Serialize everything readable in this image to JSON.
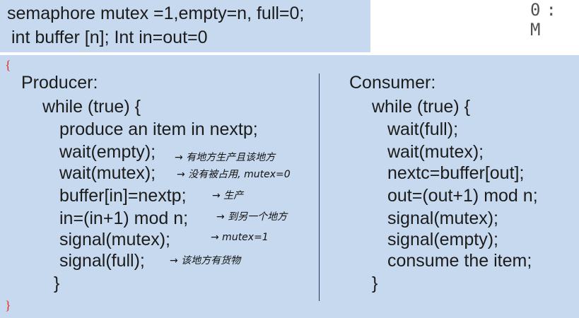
{
  "header": {
    "line1": "semaphore mutex =1,empty=n, full=0;",
    "line2": "int buffer [n];  Int in=out=0"
  },
  "corner_text": "0: M",
  "braces": {
    "open": "{",
    "close": "}"
  },
  "producer": {
    "title": "Producer:",
    "lines": [
      "while (true) {",
      "produce an item in nextp;",
      "wait(empty);",
      "wait(mutex);",
      "buffer[in]=nextp;",
      "in=(in+1) mod n;",
      "signal(mutex);",
      "signal(full);",
      "}"
    ]
  },
  "consumer": {
    "title": "Consumer:",
    "lines": [
      "while (true) {",
      "wait(full);",
      "wait(mutex);",
      "nextc=buffer[out];",
      "out=(out+1) mod n;",
      "signal(mutex);",
      "signal(empty);",
      "consume the item;",
      "}"
    ]
  },
  "annotations": {
    "wait_empty": "→ 有地方生产且该地方",
    "wait_mutex": "→          没有被占用, mutex=0",
    "buffer": "→ 生产",
    "in": "→ 到另一个地方",
    "signal_mutex": "→ mutex=1",
    "signal_full": "→ 该地方有货物"
  }
}
